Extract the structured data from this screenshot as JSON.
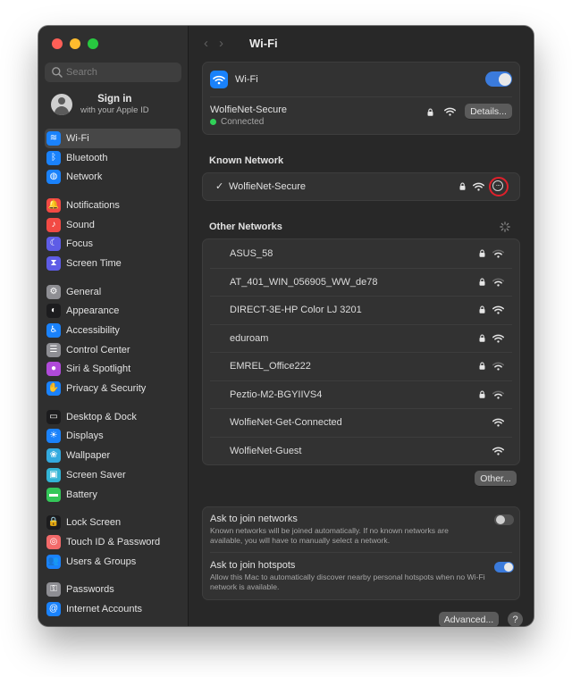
{
  "sidebar": {
    "search": {
      "placeholder": "Search"
    },
    "account": {
      "name": "Sign in",
      "subtitle": "with your Apple ID"
    },
    "items": [
      {
        "label": "Wi-Fi",
        "icon": "wifi-icon",
        "color": "#1a82fb",
        "glyph": "≋",
        "selected": true
      },
      {
        "label": "Bluetooth",
        "icon": "bluetooth-icon",
        "color": "#1a82fb",
        "glyph": "ᛒ"
      },
      {
        "label": "Network",
        "icon": "network-globe-icon",
        "color": "#1a82fb",
        "glyph": "◍"
      },
      {
        "label": "Notifications",
        "icon": "bell-icon",
        "color": "#f24a44",
        "glyph": "🔔",
        "group_start": true
      },
      {
        "label": "Sound",
        "icon": "speaker-icon",
        "color": "#f24a44",
        "glyph": "♪"
      },
      {
        "label": "Focus",
        "icon": "moon-icon",
        "color": "#5e5ce6",
        "glyph": "☾"
      },
      {
        "label": "Screen Time",
        "icon": "hourglass-icon",
        "color": "#5e5ce6",
        "glyph": "⧗"
      },
      {
        "label": "General",
        "icon": "gear-icon",
        "color": "#8e8e93",
        "glyph": "⚙",
        "group_start": true
      },
      {
        "label": "Appearance",
        "icon": "appearance-icon",
        "color": "#1c1c1e",
        "glyph": "◐"
      },
      {
        "label": "Accessibility",
        "icon": "accessibility-icon",
        "color": "#1a82fb",
        "glyph": "♿"
      },
      {
        "label": "Control Center",
        "icon": "control-center-icon",
        "color": "#8e8e93",
        "glyph": "☰"
      },
      {
        "label": "Siri & Spotlight",
        "icon": "siri-icon",
        "color": "#b04ad9",
        "glyph": "●"
      },
      {
        "label": "Privacy & Security",
        "icon": "hand-icon",
        "color": "#1a82fb",
        "glyph": "✋"
      },
      {
        "label": "Desktop & Dock",
        "icon": "dock-icon",
        "color": "#1c1c1e",
        "glyph": "▭",
        "group_start": true
      },
      {
        "label": "Displays",
        "icon": "sun-icon",
        "color": "#1a82fb",
        "glyph": "☀"
      },
      {
        "label": "Wallpaper",
        "icon": "wallpaper-icon",
        "color": "#33aadf",
        "glyph": "❀"
      },
      {
        "label": "Screen Saver",
        "icon": "screen-saver-icon",
        "color": "#33b5d6",
        "glyph": "▣"
      },
      {
        "label": "Battery",
        "icon": "battery-icon",
        "color": "#34c759",
        "glyph": "▬"
      },
      {
        "label": "Lock Screen",
        "icon": "lock-icon",
        "color": "#1c1c1e",
        "glyph": "🔒",
        "group_start": true
      },
      {
        "label": "Touch ID & Password",
        "icon": "fingerprint-icon",
        "color": "#f26a6a",
        "glyph": "◎"
      },
      {
        "label": "Users & Groups",
        "icon": "users-icon",
        "color": "#1a82fb",
        "glyph": "👥"
      },
      {
        "label": "Passwords",
        "icon": "key-icon",
        "color": "#8e8e93",
        "glyph": "⚿",
        "group_start": true
      },
      {
        "label": "Internet Accounts",
        "icon": "at-icon",
        "color": "#1a82fb",
        "glyph": "@"
      }
    ]
  },
  "main": {
    "title": "Wi-Fi",
    "wifi": {
      "label": "Wi-Fi",
      "enabled": true
    },
    "current": {
      "name": "WolfieNet-Secure",
      "status": "Connected",
      "status_color": "#30d158",
      "details_label": "Details..."
    },
    "known": {
      "title": "Known Network",
      "name": "WolfieNet-Secure",
      "check": "✓"
    },
    "other": {
      "title": "Other Networks",
      "networks": [
        {
          "name": "ASUS_58",
          "locked": true,
          "strong": false
        },
        {
          "name": "AT_401_WIN_056905_WW_de78",
          "locked": true,
          "strong": false
        },
        {
          "name": "DIRECT-3E-HP Color LJ 3201",
          "locked": true,
          "strong": true
        },
        {
          "name": "eduroam",
          "locked": true,
          "strong": true
        },
        {
          "name": "EMREL_Office222",
          "locked": true,
          "strong": false
        },
        {
          "name": "Peztio-M2-BGYIIVS4",
          "locked": true,
          "strong": false
        },
        {
          "name": "WolfieNet-Get-Connected",
          "locked": false,
          "strong": true
        },
        {
          "name": "WolfieNet-Guest",
          "locked": false,
          "strong": true
        }
      ],
      "other_button": "Other..."
    },
    "ask_networks": {
      "title": "Ask to join networks",
      "desc": "Known networks will be joined automatically. If no known networks are available, you will have to manually select a network.",
      "enabled": false
    },
    "ask_hotspots": {
      "title": "Ask to join hotspots",
      "desc": "Allow this Mac to automatically discover nearby personal hotspots when no Wi-Fi network is available.",
      "enabled": true
    },
    "advanced_label": "Advanced...",
    "help_label": "?"
  }
}
